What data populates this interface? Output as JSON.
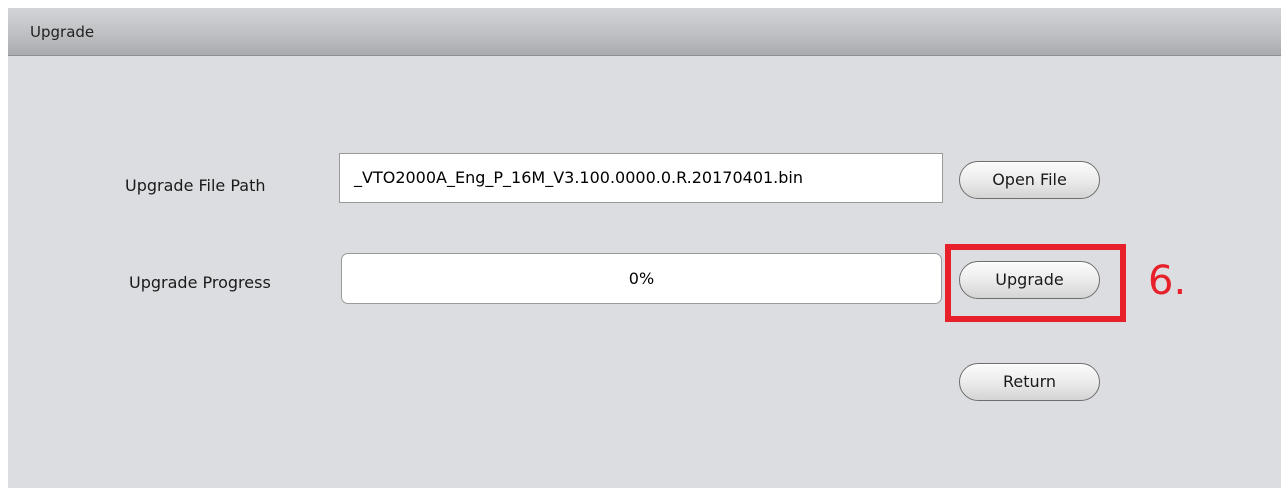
{
  "window": {
    "title": "Upgrade"
  },
  "form": {
    "file_path_label": "Upgrade File Path",
    "file_path_value": "_VTO2000A_Eng_P_16M_V3.100.0000.0.R.20170401.bin",
    "progress_label": "Upgrade Progress",
    "progress_text": "0%",
    "progress_fraction": 0
  },
  "buttons": {
    "open_file": "Open File",
    "upgrade": "Upgrade",
    "return": "Return"
  },
  "annotation": {
    "step_number": "6.",
    "color": "#e8202a"
  }
}
